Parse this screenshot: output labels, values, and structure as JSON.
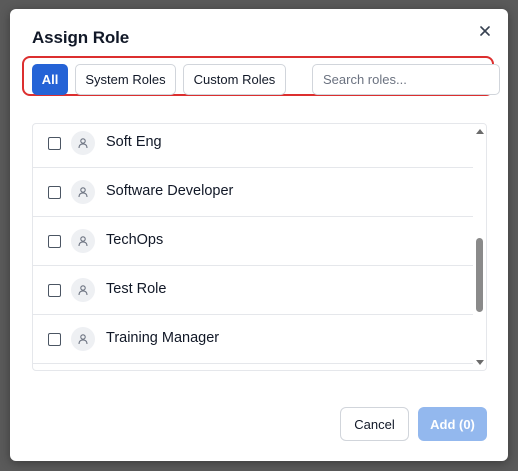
{
  "dialog": {
    "title": "Assign Role",
    "close_icon": "close-icon"
  },
  "filters": {
    "all_label": "All",
    "system_label": "System Roles",
    "custom_label": "Custom Roles",
    "active": "All",
    "search_placeholder": "Search roles...",
    "search_value": ""
  },
  "roles": [
    {
      "label": "Soft Eng",
      "checked": false,
      "icon": "user-icon"
    },
    {
      "label": "Software Developer",
      "checked": false,
      "icon": "user-icon"
    },
    {
      "label": "TechOps",
      "checked": false,
      "icon": "user-icon"
    },
    {
      "label": "Test Role",
      "checked": false,
      "icon": "user-icon"
    },
    {
      "label": "Training Manager",
      "checked": false,
      "icon": "user-icon"
    }
  ],
  "footer": {
    "cancel_label": "Cancel",
    "add_label": "Add (0)"
  },
  "colors": {
    "accent": "#2563d6",
    "highlight_border": "#dc2f2f",
    "add_disabled": "#93b8ee"
  }
}
